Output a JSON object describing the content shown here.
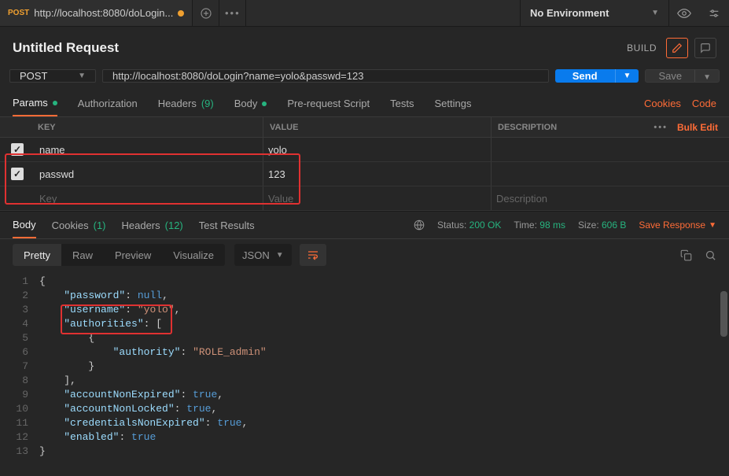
{
  "tab": {
    "method": "POST",
    "title": "http://localhost:8080/doLogin..."
  },
  "header": {
    "name": "Untitled Request",
    "build": "BUILD",
    "env": "No Environment"
  },
  "url_row": {
    "method": "POST",
    "url": "http://localhost:8080/doLogin?name=yolo&passwd=123",
    "send": "Send",
    "save": "Save"
  },
  "req_tabs": {
    "params": "Params",
    "auth": "Authorization",
    "headers": "Headers",
    "headers_count": "(9)",
    "body": "Body",
    "prereq": "Pre-request Script",
    "tests": "Tests",
    "settings": "Settings",
    "cookies": "Cookies",
    "code": "Code"
  },
  "params_table": {
    "head_key": "KEY",
    "head_value": "VALUE",
    "head_desc": "DESCRIPTION",
    "bulk": "Bulk Edit",
    "rows": [
      {
        "key": "name",
        "value": "yolo"
      },
      {
        "key": "passwd",
        "value": "123"
      }
    ],
    "placeholder_key": "Key",
    "placeholder_value": "Value",
    "placeholder_desc": "Description"
  },
  "resp_tabs": {
    "body": "Body",
    "cookies": "Cookies",
    "cookies_count": "(1)",
    "headers": "Headers",
    "headers_count": "(12)",
    "tests": "Test Results"
  },
  "resp_status": {
    "status_label": "Status:",
    "status_value": "200 OK",
    "time_label": "Time:",
    "time_value": "98 ms",
    "size_label": "Size:",
    "size_value": "606 B",
    "save_response": "Save Response"
  },
  "resp_toolbar": {
    "pretty": "Pretty",
    "raw": "Raw",
    "preview": "Preview",
    "visualize": "Visualize",
    "format": "JSON"
  },
  "response_json": {
    "password": null,
    "username": "yolo",
    "authorities": [
      {
        "authority": "ROLE_admin"
      }
    ],
    "accountNonExpired": true,
    "accountNonLocked": true,
    "credentialsNonExpired": true,
    "enabled": true
  },
  "code_lines": [
    [
      {
        "t": "p",
        "v": "{"
      }
    ],
    [
      {
        "t": "p",
        "v": "    "
      },
      {
        "t": "key",
        "v": "\"password\""
      },
      {
        "t": "p",
        "v": ": "
      },
      {
        "t": "kw",
        "v": "null"
      },
      {
        "t": "p",
        "v": ","
      }
    ],
    [
      {
        "t": "p",
        "v": "    "
      },
      {
        "t": "key",
        "v": "\"username\""
      },
      {
        "t": "p",
        "v": ": "
      },
      {
        "t": "str",
        "v": "\"yolo\""
      },
      {
        "t": "p",
        "v": ","
      }
    ],
    [
      {
        "t": "p",
        "v": "    "
      },
      {
        "t": "key",
        "v": "\"authorities\""
      },
      {
        "t": "p",
        "v": ": ["
      }
    ],
    [
      {
        "t": "p",
        "v": "        {"
      }
    ],
    [
      {
        "t": "p",
        "v": "            "
      },
      {
        "t": "key",
        "v": "\"authority\""
      },
      {
        "t": "p",
        "v": ": "
      },
      {
        "t": "str",
        "v": "\"ROLE_admin\""
      }
    ],
    [
      {
        "t": "p",
        "v": "        }"
      }
    ],
    [
      {
        "t": "p",
        "v": "    ],"
      }
    ],
    [
      {
        "t": "p",
        "v": "    "
      },
      {
        "t": "key",
        "v": "\"accountNonExpired\""
      },
      {
        "t": "p",
        "v": ": "
      },
      {
        "t": "kw",
        "v": "true"
      },
      {
        "t": "p",
        "v": ","
      }
    ],
    [
      {
        "t": "p",
        "v": "    "
      },
      {
        "t": "key",
        "v": "\"accountNonLocked\""
      },
      {
        "t": "p",
        "v": ": "
      },
      {
        "t": "kw",
        "v": "true"
      },
      {
        "t": "p",
        "v": ","
      }
    ],
    [
      {
        "t": "p",
        "v": "    "
      },
      {
        "t": "key",
        "v": "\"credentialsNonExpired\""
      },
      {
        "t": "p",
        "v": ": "
      },
      {
        "t": "kw",
        "v": "true"
      },
      {
        "t": "p",
        "v": ","
      }
    ],
    [
      {
        "t": "p",
        "v": "    "
      },
      {
        "t": "key",
        "v": "\"enabled\""
      },
      {
        "t": "p",
        "v": ": "
      },
      {
        "t": "kw",
        "v": "true"
      }
    ],
    [
      {
        "t": "p",
        "v": "}"
      }
    ]
  ]
}
